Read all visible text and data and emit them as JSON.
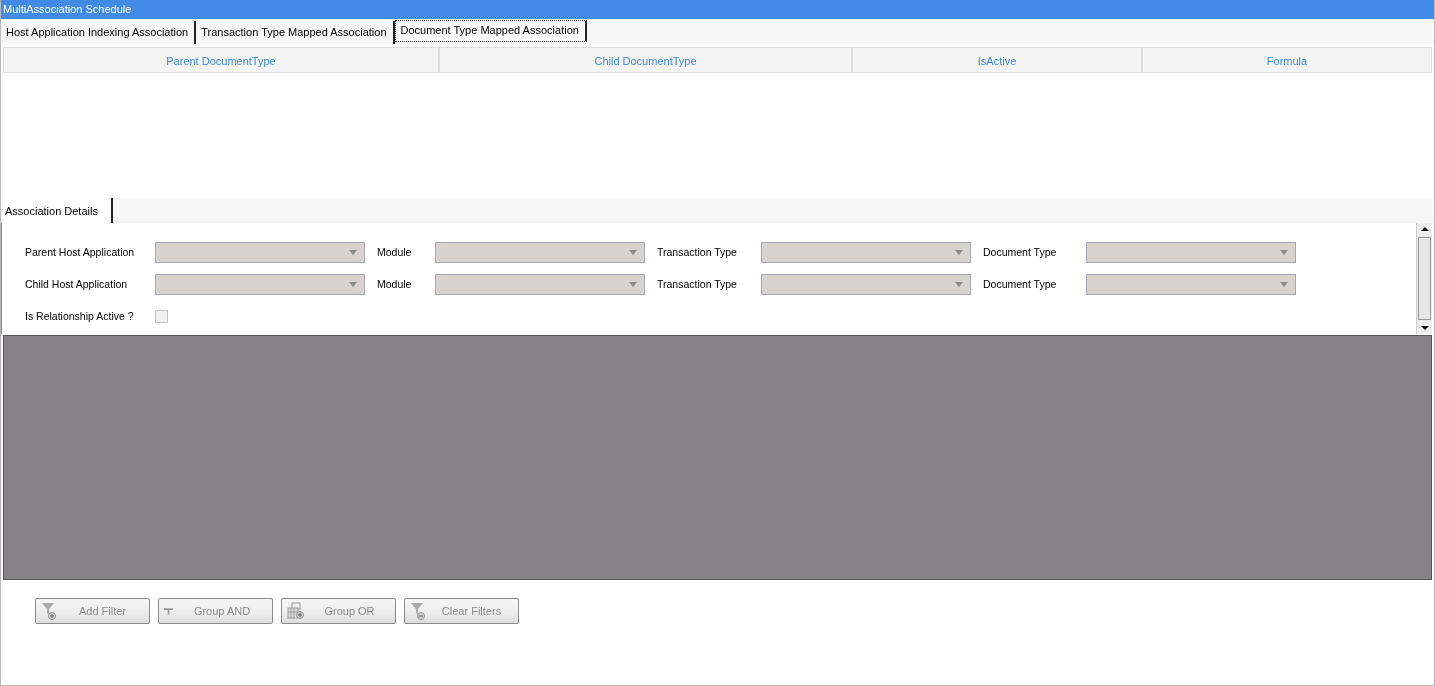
{
  "window": {
    "title": "MultiAssociation Schedule"
  },
  "tabs": [
    {
      "label": "Host Application Indexing Association",
      "selected": false
    },
    {
      "label": "Transaction Type Mapped Association",
      "selected": false
    },
    {
      "label": "Document Type Mapped Association",
      "selected": true
    }
  ],
  "grid": {
    "columns": [
      "Parent DocumentType",
      "Child DocumentType",
      "IsActive",
      "Formula"
    ]
  },
  "details_tabs": [
    {
      "label": "Association Details",
      "selected": true
    }
  ],
  "form": {
    "rows": [
      {
        "fields": [
          {
            "label": "Parent Host Application",
            "disabled": true
          },
          {
            "label": "Module",
            "disabled": true
          },
          {
            "label": "Transaction Type",
            "disabled": true
          },
          {
            "label": "Document Type",
            "disabled": true
          }
        ]
      },
      {
        "fields": [
          {
            "label": "Child Host Application",
            "disabled": true
          },
          {
            "label": "Module",
            "disabled": true
          },
          {
            "label": "Transaction Type",
            "disabled": true
          },
          {
            "label": "Document Type",
            "disabled": true
          }
        ]
      }
    ],
    "active": {
      "label": "Is Relationship Active ?",
      "checked": false,
      "disabled": true
    }
  },
  "filter_buttons": [
    {
      "label": "Add Filter",
      "kind": "add",
      "disabled": true
    },
    {
      "label": "Group AND",
      "kind": "and",
      "disabled": true
    },
    {
      "label": "Group OR",
      "kind": "or",
      "disabled": true
    },
    {
      "label": "Clear Filters",
      "kind": "clear",
      "disabled": true
    }
  ]
}
